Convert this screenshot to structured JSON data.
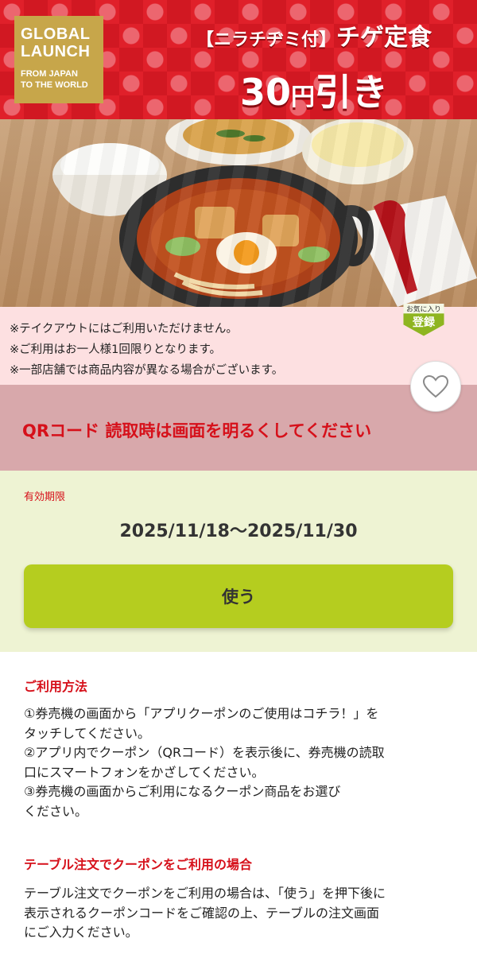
{
  "banner": {
    "logo_line1": "GLOBAL",
    "logo_line2": "LAUNCH",
    "logo_line3": "FROM JAPAN",
    "logo_line4": "TO THE WORLD",
    "title_prefix": "【ニラチヂミ付】",
    "title_main": "チゲ定食",
    "price_number": "30",
    "price_yen": "円",
    "price_suffix": "引き"
  },
  "notice": {
    "lines": [
      "※テイクアウトにはご利用いただけません。",
      "※ご利用はお一人様1回限りとなります。",
      "※一部店舗では商品内容が異なる場合がございます。"
    ],
    "fav_badge_top": "お気に入り",
    "fav_badge_main": "登録"
  },
  "qr_notice": "QRコード 読取時は画面を明るくしてください",
  "validity": {
    "label": "有効期限",
    "dates": "2025/11/18〜2025/11/30"
  },
  "use_button": "使う",
  "howto": {
    "title": "ご利用方法",
    "lines": [
      "①券売機の画面から「アプリクーポンのご使用はコチラ！」を",
      "タッチしてください。",
      "②アプリ内でクーポン（QRコード）を表示後に、券売機の読取",
      "口にスマートフォンをかざしてください。",
      "③券売機の画面からご利用になるクーポン商品をお選び",
      "ください。"
    ]
  },
  "table_order": {
    "title": "テーブル注文でクーポンをご利用の場合",
    "lines": [
      "テーブル注文でクーポンをご利用の場合は、「使う」を押下後に",
      "表示されるクーポンコードをご確認の上、テーブルの注文画面",
      "にご入力ください。"
    ]
  },
  "colors": {
    "accent_red": "#d6101a",
    "use_button_green": "#b5cd1f",
    "logo_gold": "#c7a64a"
  }
}
